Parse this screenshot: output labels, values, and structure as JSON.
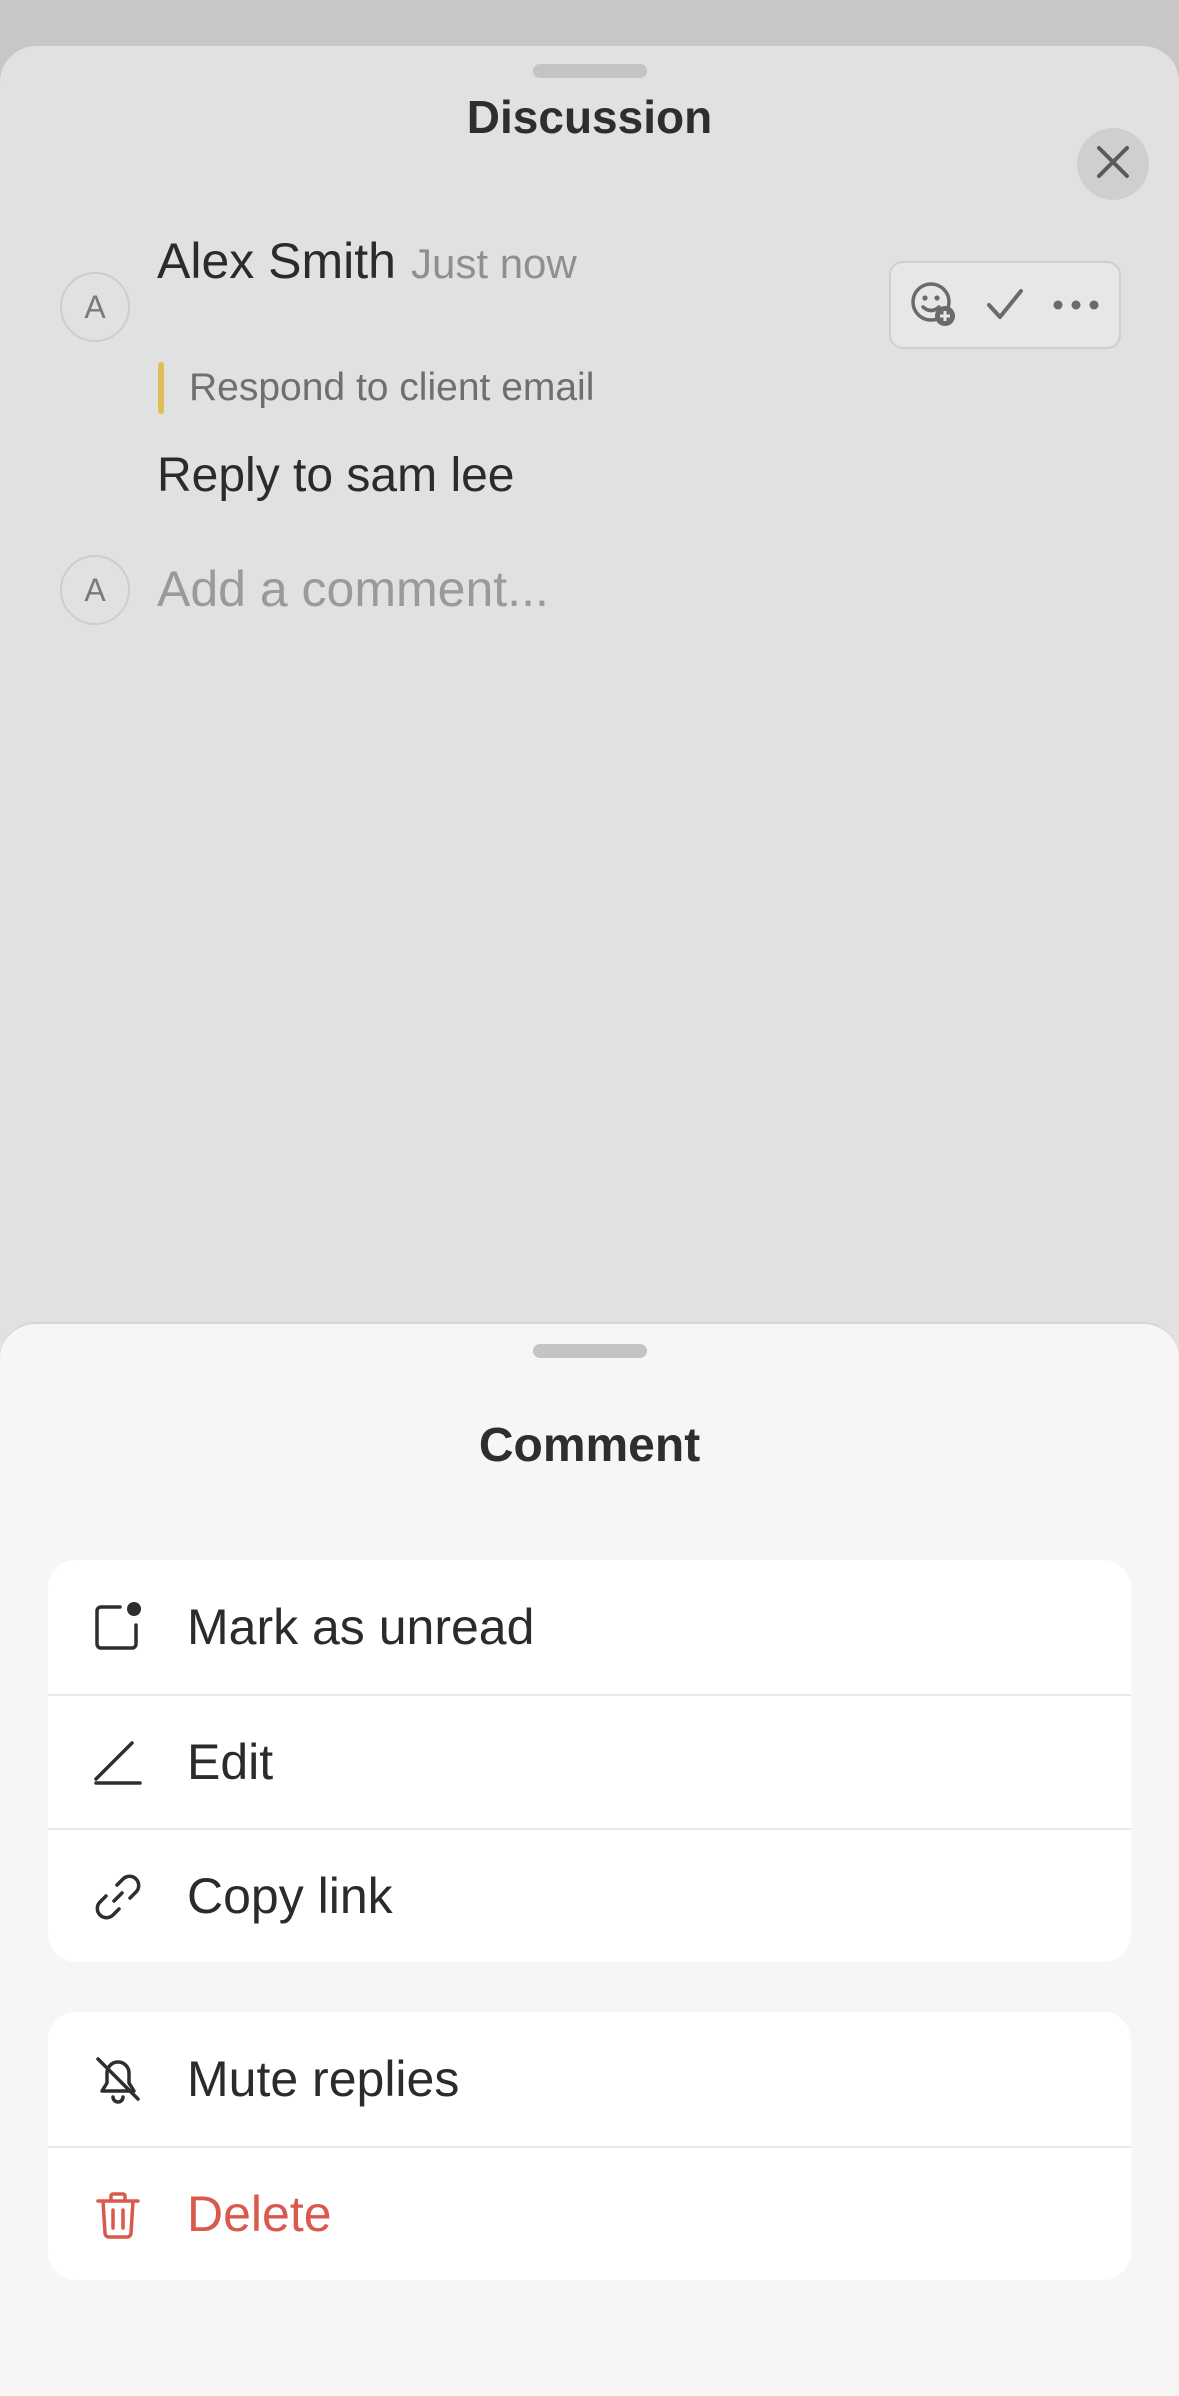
{
  "discussion": {
    "title": "Discussion",
    "comment": {
      "avatar_initial": "A",
      "author": "Alex Smith",
      "timestamp": "Just now",
      "quoted_task": "Respond to client email",
      "body": "Reply to sam lee"
    },
    "composer": {
      "avatar_initial": "A",
      "placeholder": "Add a comment..."
    },
    "actions": [
      "add-reaction-icon",
      "resolve-check-icon",
      "more-options-icon"
    ]
  },
  "comment_sheet": {
    "title": "Comment",
    "group1": [
      {
        "label": "Mark as unread",
        "icon": "mark-unread-icon"
      },
      {
        "label": "Edit",
        "icon": "pencil-icon"
      },
      {
        "label": "Copy link",
        "icon": "link-icon"
      }
    ],
    "group2": [
      {
        "label": "Mute replies",
        "icon": "bell-off-icon"
      },
      {
        "label": "Delete",
        "icon": "trash-icon"
      }
    ]
  },
  "colors": {
    "quote_accent": "#dfbe55",
    "danger": "#d9594c"
  }
}
